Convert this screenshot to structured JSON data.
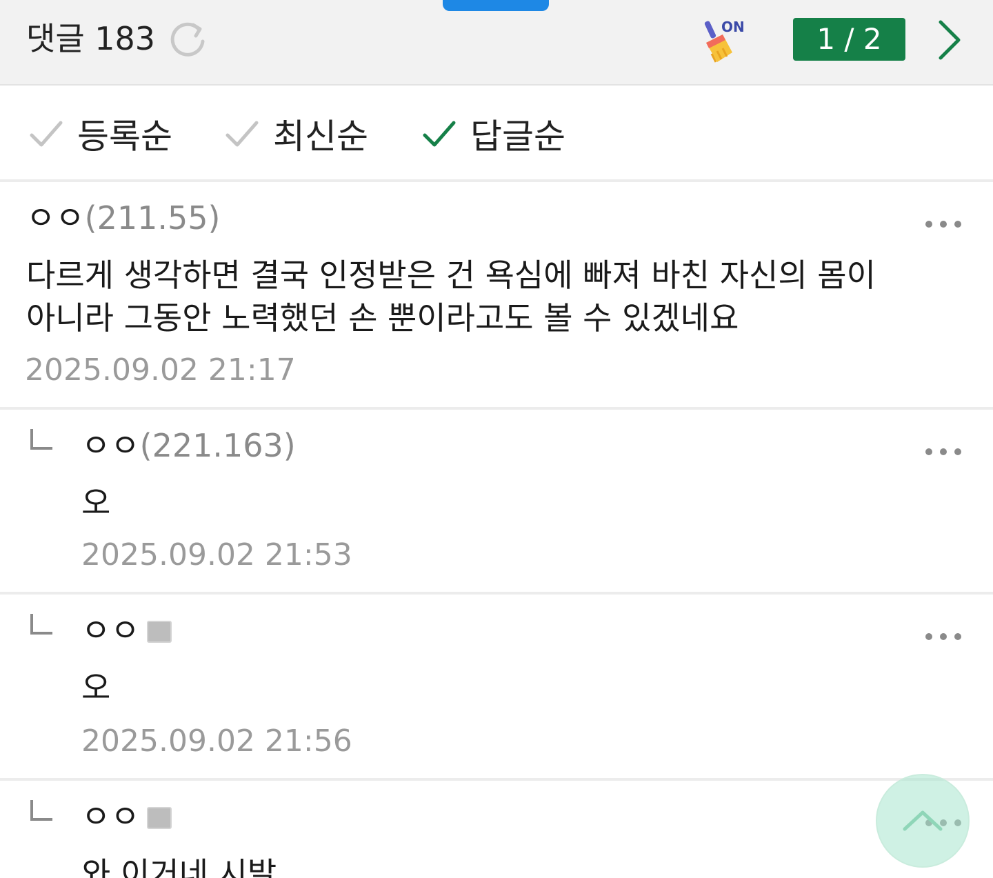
{
  "header": {
    "title": "댓글 183",
    "cleaner_badge": "ON",
    "page_indicator": "1 / 2"
  },
  "sort": {
    "options": [
      {
        "label": "등록순",
        "selected": false
      },
      {
        "label": "최신순",
        "selected": false
      },
      {
        "label": "답글순",
        "selected": true
      }
    ]
  },
  "comments": [
    {
      "nick": "ㅇㅇ",
      "ip": "(211.55)",
      "text_line1": "다르게 생각하면 결국 인정받은 건 욕심에 빠져 바친 자신의 몸이",
      "text_line2": "아니라 그동안 노력했던 손 뿐이라고도 볼 수 있겠네요",
      "time": "2025.09.02 21:17"
    },
    {
      "nick": "ㅇㅇ",
      "ip": "(221.163)",
      "text": "오",
      "time": "2025.09.02 21:53"
    },
    {
      "nick": "ㅇㅇ",
      "text": "오",
      "time": "2025.09.02 21:56"
    },
    {
      "nick": "ㅇㅇ",
      "text": "와 이거네 시발"
    }
  ],
  "colors": {
    "accent_green": "#158048",
    "handle_blue": "#1e88e5",
    "muted_gray": "#9a9a9a"
  }
}
